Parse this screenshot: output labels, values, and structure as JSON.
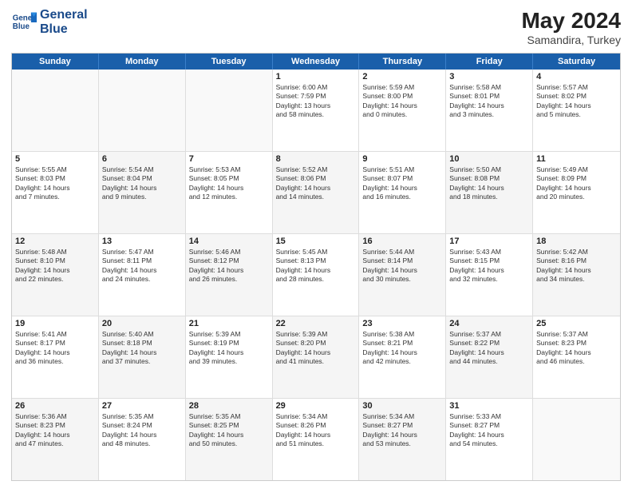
{
  "header": {
    "logo_line1": "General",
    "logo_line2": "Blue",
    "title": "May 2024",
    "subtitle": "Samandira, Turkey"
  },
  "days_of_week": [
    "Sunday",
    "Monday",
    "Tuesday",
    "Wednesday",
    "Thursday",
    "Friday",
    "Saturday"
  ],
  "rows": [
    [
      {
        "day": "",
        "empty": true,
        "lines": []
      },
      {
        "day": "",
        "empty": true,
        "lines": []
      },
      {
        "day": "",
        "empty": true,
        "lines": []
      },
      {
        "day": "1",
        "empty": false,
        "lines": [
          "Sunrise: 6:00 AM",
          "Sunset: 7:59 PM",
          "Daylight: 13 hours",
          "and 58 minutes."
        ]
      },
      {
        "day": "2",
        "empty": false,
        "lines": [
          "Sunrise: 5:59 AM",
          "Sunset: 8:00 PM",
          "Daylight: 14 hours",
          "and 0 minutes."
        ]
      },
      {
        "day": "3",
        "empty": false,
        "lines": [
          "Sunrise: 5:58 AM",
          "Sunset: 8:01 PM",
          "Daylight: 14 hours",
          "and 3 minutes."
        ]
      },
      {
        "day": "4",
        "empty": false,
        "lines": [
          "Sunrise: 5:57 AM",
          "Sunset: 8:02 PM",
          "Daylight: 14 hours",
          "and 5 minutes."
        ]
      }
    ],
    [
      {
        "day": "5",
        "empty": false,
        "alt": false,
        "lines": [
          "Sunrise: 5:55 AM",
          "Sunset: 8:03 PM",
          "Daylight: 14 hours",
          "and 7 minutes."
        ]
      },
      {
        "day": "6",
        "empty": false,
        "alt": true,
        "lines": [
          "Sunrise: 5:54 AM",
          "Sunset: 8:04 PM",
          "Daylight: 14 hours",
          "and 9 minutes."
        ]
      },
      {
        "day": "7",
        "empty": false,
        "alt": false,
        "lines": [
          "Sunrise: 5:53 AM",
          "Sunset: 8:05 PM",
          "Daylight: 14 hours",
          "and 12 minutes."
        ]
      },
      {
        "day": "8",
        "empty": false,
        "alt": true,
        "lines": [
          "Sunrise: 5:52 AM",
          "Sunset: 8:06 PM",
          "Daylight: 14 hours",
          "and 14 minutes."
        ]
      },
      {
        "day": "9",
        "empty": false,
        "alt": false,
        "lines": [
          "Sunrise: 5:51 AM",
          "Sunset: 8:07 PM",
          "Daylight: 14 hours",
          "and 16 minutes."
        ]
      },
      {
        "day": "10",
        "empty": false,
        "alt": true,
        "lines": [
          "Sunrise: 5:50 AM",
          "Sunset: 8:08 PM",
          "Daylight: 14 hours",
          "and 18 minutes."
        ]
      },
      {
        "day": "11",
        "empty": false,
        "alt": false,
        "lines": [
          "Sunrise: 5:49 AM",
          "Sunset: 8:09 PM",
          "Daylight: 14 hours",
          "and 20 minutes."
        ]
      }
    ],
    [
      {
        "day": "12",
        "empty": false,
        "alt": true,
        "lines": [
          "Sunrise: 5:48 AM",
          "Sunset: 8:10 PM",
          "Daylight: 14 hours",
          "and 22 minutes."
        ]
      },
      {
        "day": "13",
        "empty": false,
        "alt": false,
        "lines": [
          "Sunrise: 5:47 AM",
          "Sunset: 8:11 PM",
          "Daylight: 14 hours",
          "and 24 minutes."
        ]
      },
      {
        "day": "14",
        "empty": false,
        "alt": true,
        "lines": [
          "Sunrise: 5:46 AM",
          "Sunset: 8:12 PM",
          "Daylight: 14 hours",
          "and 26 minutes."
        ]
      },
      {
        "day": "15",
        "empty": false,
        "alt": false,
        "lines": [
          "Sunrise: 5:45 AM",
          "Sunset: 8:13 PM",
          "Daylight: 14 hours",
          "and 28 minutes."
        ]
      },
      {
        "day": "16",
        "empty": false,
        "alt": true,
        "lines": [
          "Sunrise: 5:44 AM",
          "Sunset: 8:14 PM",
          "Daylight: 14 hours",
          "and 30 minutes."
        ]
      },
      {
        "day": "17",
        "empty": false,
        "alt": false,
        "lines": [
          "Sunrise: 5:43 AM",
          "Sunset: 8:15 PM",
          "Daylight: 14 hours",
          "and 32 minutes."
        ]
      },
      {
        "day": "18",
        "empty": false,
        "alt": true,
        "lines": [
          "Sunrise: 5:42 AM",
          "Sunset: 8:16 PM",
          "Daylight: 14 hours",
          "and 34 minutes."
        ]
      }
    ],
    [
      {
        "day": "19",
        "empty": false,
        "alt": false,
        "lines": [
          "Sunrise: 5:41 AM",
          "Sunset: 8:17 PM",
          "Daylight: 14 hours",
          "and 36 minutes."
        ]
      },
      {
        "day": "20",
        "empty": false,
        "alt": true,
        "lines": [
          "Sunrise: 5:40 AM",
          "Sunset: 8:18 PM",
          "Daylight: 14 hours",
          "and 37 minutes."
        ]
      },
      {
        "day": "21",
        "empty": false,
        "alt": false,
        "lines": [
          "Sunrise: 5:39 AM",
          "Sunset: 8:19 PM",
          "Daylight: 14 hours",
          "and 39 minutes."
        ]
      },
      {
        "day": "22",
        "empty": false,
        "alt": true,
        "lines": [
          "Sunrise: 5:39 AM",
          "Sunset: 8:20 PM",
          "Daylight: 14 hours",
          "and 41 minutes."
        ]
      },
      {
        "day": "23",
        "empty": false,
        "alt": false,
        "lines": [
          "Sunrise: 5:38 AM",
          "Sunset: 8:21 PM",
          "Daylight: 14 hours",
          "and 42 minutes."
        ]
      },
      {
        "day": "24",
        "empty": false,
        "alt": true,
        "lines": [
          "Sunrise: 5:37 AM",
          "Sunset: 8:22 PM",
          "Daylight: 14 hours",
          "and 44 minutes."
        ]
      },
      {
        "day": "25",
        "empty": false,
        "alt": false,
        "lines": [
          "Sunrise: 5:37 AM",
          "Sunset: 8:23 PM",
          "Daylight: 14 hours",
          "and 46 minutes."
        ]
      }
    ],
    [
      {
        "day": "26",
        "empty": false,
        "alt": true,
        "lines": [
          "Sunrise: 5:36 AM",
          "Sunset: 8:23 PM",
          "Daylight: 14 hours",
          "and 47 minutes."
        ]
      },
      {
        "day": "27",
        "empty": false,
        "alt": false,
        "lines": [
          "Sunrise: 5:35 AM",
          "Sunset: 8:24 PM",
          "Daylight: 14 hours",
          "and 48 minutes."
        ]
      },
      {
        "day": "28",
        "empty": false,
        "alt": true,
        "lines": [
          "Sunrise: 5:35 AM",
          "Sunset: 8:25 PM",
          "Daylight: 14 hours",
          "and 50 minutes."
        ]
      },
      {
        "day": "29",
        "empty": false,
        "alt": false,
        "lines": [
          "Sunrise: 5:34 AM",
          "Sunset: 8:26 PM",
          "Daylight: 14 hours",
          "and 51 minutes."
        ]
      },
      {
        "day": "30",
        "empty": false,
        "alt": true,
        "lines": [
          "Sunrise: 5:34 AM",
          "Sunset: 8:27 PM",
          "Daylight: 14 hours",
          "and 53 minutes."
        ]
      },
      {
        "day": "31",
        "empty": false,
        "alt": false,
        "lines": [
          "Sunrise: 5:33 AM",
          "Sunset: 8:27 PM",
          "Daylight: 14 hours",
          "and 54 minutes."
        ]
      },
      {
        "day": "",
        "empty": true,
        "lines": []
      }
    ]
  ]
}
